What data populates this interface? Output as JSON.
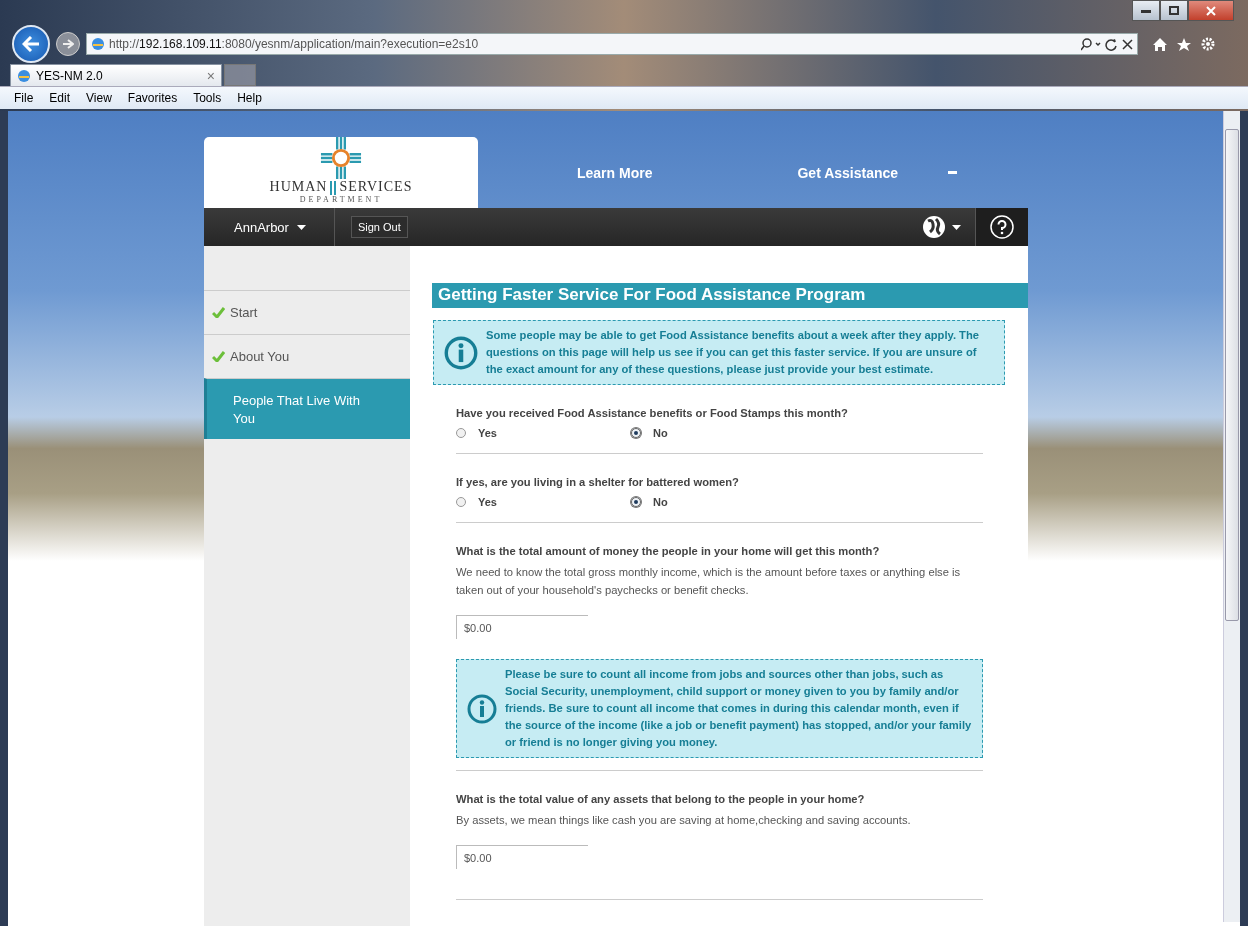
{
  "browser": {
    "address": "http://**192.168.109.11**:8080/yesnm/application/main?execution=e2s10",
    "tab": {
      "title": "YES-NM 2.0",
      "close": "×"
    },
    "menu": [
      "File",
      "Edit",
      "View",
      "Favorites",
      "Tools",
      "Help"
    ]
  },
  "header": {
    "logo": {
      "left": "HUMAN",
      "right": "SERVICES",
      "sub": "DEPARTMENT"
    },
    "nav": [
      "Learn More",
      "Get Assistance"
    ]
  },
  "toolbar": {
    "user": "AnnArbor",
    "sign_out": "Sign Out"
  },
  "sidebar": {
    "items": [
      {
        "label": "Start",
        "checked": true,
        "selected": false
      },
      {
        "label": "About You",
        "checked": true,
        "selected": false
      },
      {
        "label": "People That Live With You",
        "checked": false,
        "selected": true
      }
    ]
  },
  "content": {
    "title": "Getting Faster Service For Food Assistance Program",
    "blocks": [
      {
        "kind": "info",
        "text": "Some people may be able to get Food Assistance benefits about a week after they apply. The questions on this page will help us see if you can get this faster service. If you are unsure of the exact amount for any of these questions, please just provide your best estimate."
      },
      {
        "kind": "radio",
        "question": "Have you received Food Assistance benefits or Food Stamps this month?",
        "options": [
          {
            "label": "Yes",
            "selected": false
          },
          {
            "label": "No",
            "selected": true
          }
        ]
      },
      {
        "kind": "radio",
        "question": "If yes, are you living in a shelter for battered women?",
        "options": [
          {
            "label": "Yes",
            "selected": false
          },
          {
            "label": "No",
            "selected": true
          }
        ]
      },
      {
        "kind": "amount",
        "question": "What is the total amount of money the people in your home will get this month?",
        "description": "We need to know the total gross monthly income, which is the amount before taxes or anything else is taken out of your household's paychecks or benefit checks.",
        "value": "$0.00"
      },
      {
        "kind": "note",
        "text": "Please be sure to count all income from jobs and sources other than jobs, such as Social Security, unemployment, child support or money given to you by family and/or friends. Be sure to count all income that comes in during this calendar month, even if the source of the income (like a job or benefit payment) has stopped, and/or your family or friend is no longer giving you money."
      },
      {
        "kind": "amount",
        "question": "What is the total value of any assets that belong to the people in your home?",
        "description": "By assets, we mean things like cash you are saving at home,checking and saving accounts.",
        "value": "$0.00"
      }
    ]
  }
}
